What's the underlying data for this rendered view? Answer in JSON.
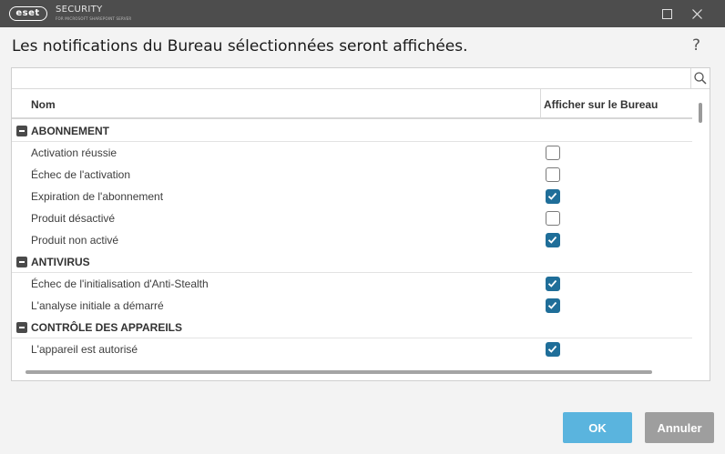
{
  "titlebar": {
    "logo": "eset",
    "product": "SECURITY",
    "product_sub": "FOR MICROSOFT SHAREPOINT SERVER",
    "maximize_icon": "square-icon",
    "close_icon": "close-icon"
  },
  "heading": "Les notifications du Bureau sélectionnées seront affichées.",
  "help": "?",
  "search": {
    "value": "",
    "placeholder": ""
  },
  "columns": {
    "name": "Nom",
    "show": "Afficher sur le Bureau"
  },
  "groups": [
    {
      "label": "ABONNEMENT",
      "items": [
        {
          "label": "Activation réussie",
          "checked": false
        },
        {
          "label": "Échec de l'activation",
          "checked": false
        },
        {
          "label": "Expiration de l'abonnement",
          "checked": true
        },
        {
          "label": "Produit désactivé",
          "checked": false
        },
        {
          "label": "Produit non activé",
          "checked": true
        }
      ]
    },
    {
      "label": "ANTIVIRUS",
      "items": [
        {
          "label": "Échec de l'initialisation d'Anti-Stealth",
          "checked": true
        },
        {
          "label": "L'analyse initiale a démarré",
          "checked": true
        }
      ]
    },
    {
      "label": "CONTRÔLE DES APPAREILS",
      "items": [
        {
          "label": "L'appareil est autorisé",
          "checked": true
        }
      ]
    }
  ],
  "buttons": {
    "ok": "OK",
    "cancel": "Annuler"
  },
  "colors": {
    "titlebar": "#4d4d4d",
    "checked": "#1f6e99",
    "ok": "#5ab4de",
    "cancel": "#9e9e9e"
  }
}
